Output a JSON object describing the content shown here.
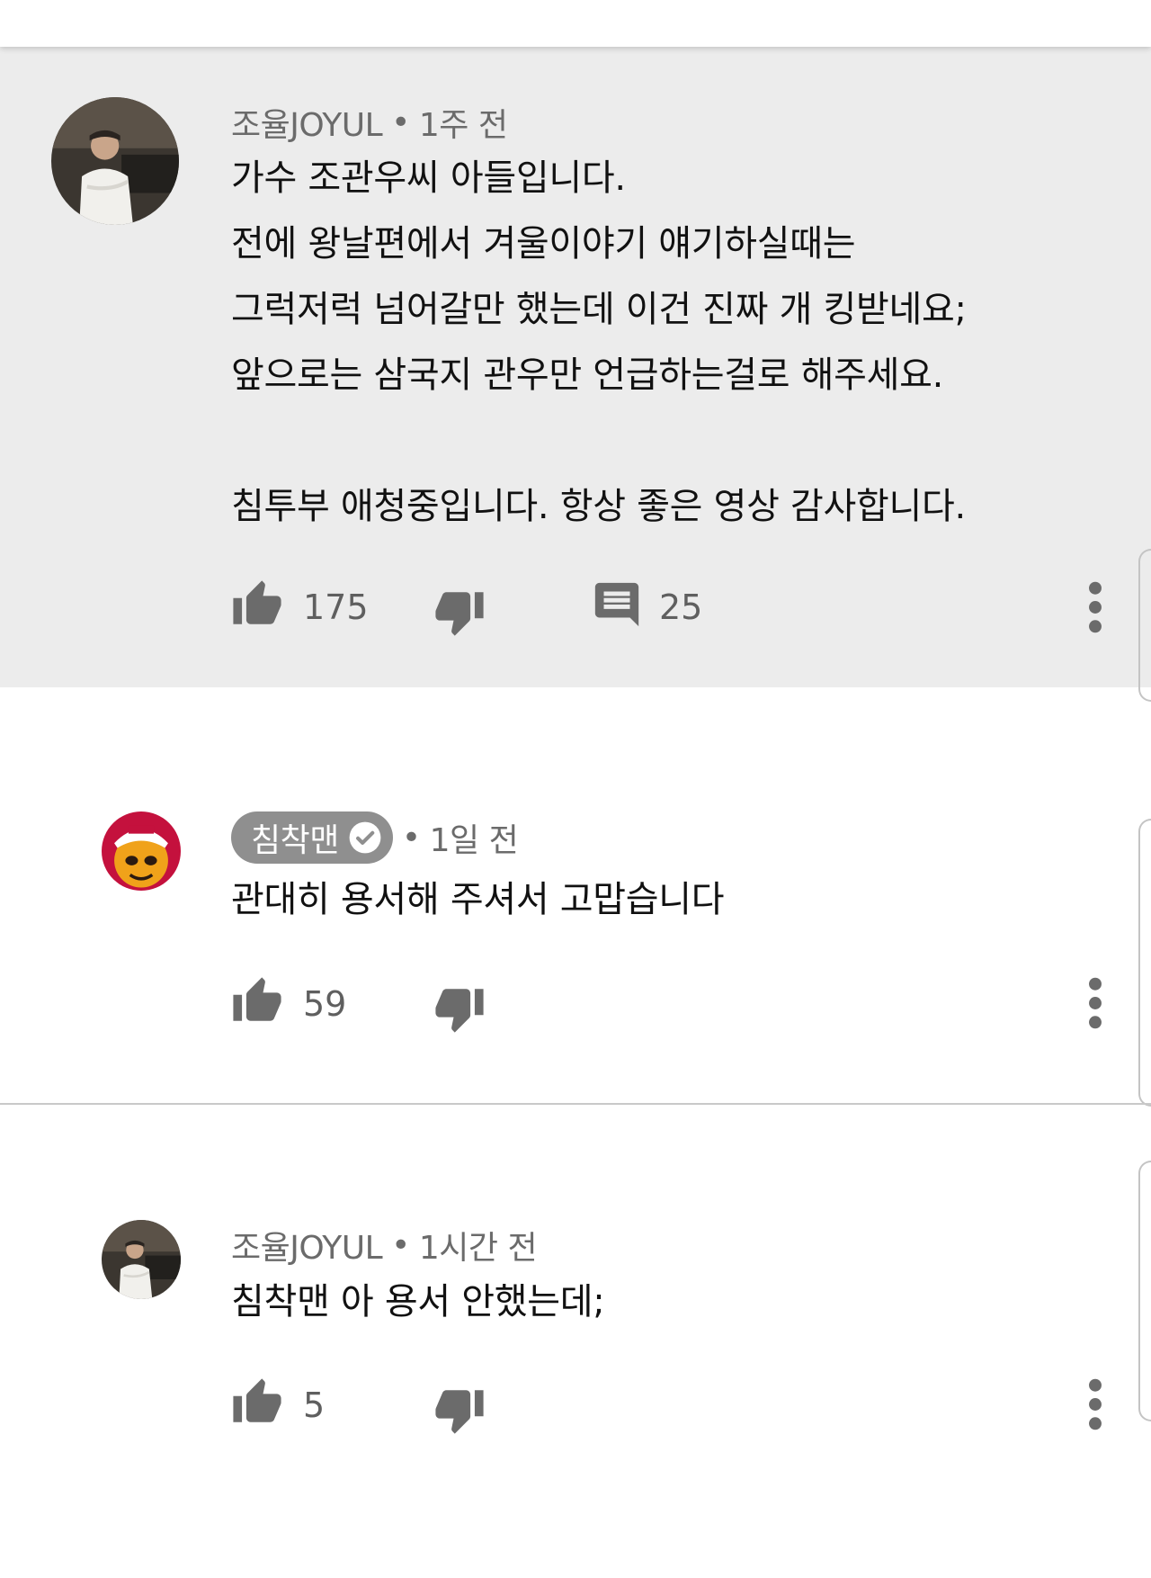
{
  "comments": [
    {
      "author": "조율JOYUL",
      "separator": "•",
      "time": "1주 전",
      "text": "가수 조관우씨 아들입니다.\n전에 왕날편에서 겨울이야기 얘기하실때는\n그럭저럭 넘어갈만 했는데 이건 진짜 개 킹받네요;\n앞으로는 삼국지 관우만 언급하는걸로 해주세요.\n\n침투부 애청중입니다. 항상 좋은 영상 감사합니다.",
      "likes": "175",
      "replies": "25"
    },
    {
      "author": "침착맨",
      "separator": "•",
      "time": "1일 전",
      "text": "관대히 용서해 주셔서 고맙습니다",
      "likes": "59"
    },
    {
      "author": "조율JOYUL",
      "separator": "•",
      "time": "1시간 전",
      "text": "침착맨 아 용서 안했는데;",
      "likes": "5"
    }
  ],
  "colors": {
    "highlight_background": "#ececec",
    "meta_text": "#6b6b6b",
    "icon": "#6b6b6b",
    "chip_background": "#8f8f8f"
  },
  "icons": [
    "thumbs-up-icon",
    "thumbs-down-icon",
    "reply-icon",
    "more-vert-icon",
    "verified-check-icon"
  ]
}
